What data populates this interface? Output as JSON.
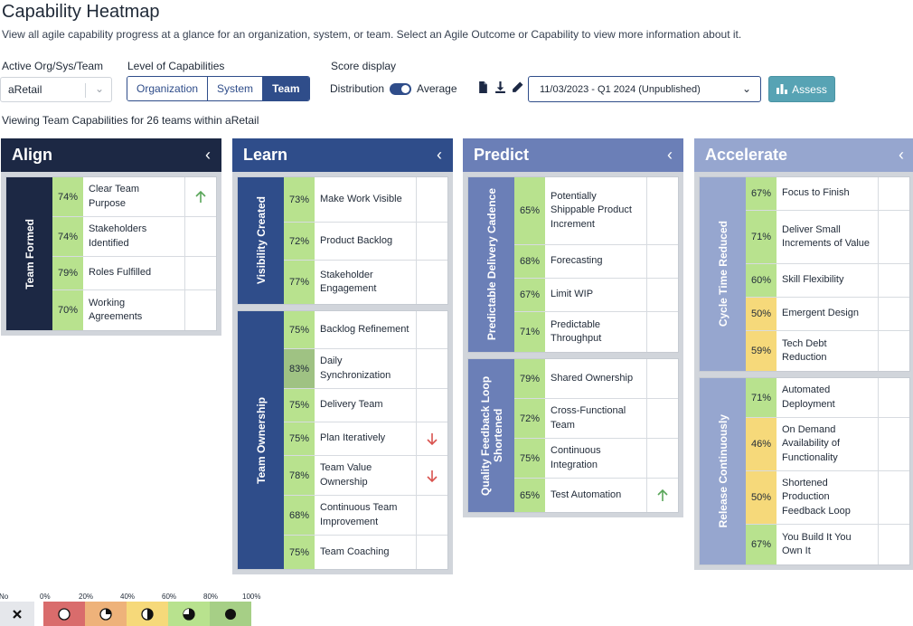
{
  "page": {
    "title": "Capability Heatmap",
    "subtitle": "View all agile capability progress at a glance for an organization, system, or team. Select an Agile Outcome or Capability to view more information about it."
  },
  "controls": {
    "org_label": "Active Org/Sys/Team",
    "org_value": "aRetail",
    "level_label": "Level of Capabilities",
    "levels": [
      "Organization",
      "System",
      "Team"
    ],
    "level_selected": "Team",
    "score_label": "Score display",
    "score_left": "Distribution",
    "score_right": "Average",
    "score_mode": "Average",
    "date_value": "11/03/2023 - Q1 2024 (Unpublished)",
    "assess_label": "Assess"
  },
  "viewing_text": "Viewing Team Capabilities for 26 teams within aRetail",
  "colors": {
    "align": "#1c2844",
    "learn": "#2f4d8a",
    "predict": "#6b7fb7",
    "accelerate": "#96a6cf",
    "scale_0_20": "#d96c6c",
    "scale_20_40": "#eeb27a",
    "scale_40_60": "#f6d97a",
    "scale_60_80": "#b8e28e",
    "scale_80_100": "#a6cf86",
    "no_value": "#e5e7eb"
  },
  "columns": [
    {
      "title": "Align",
      "groups": [
        {
          "label": "Team Formed",
          "rows": [
            {
              "pct": "74%",
              "name": "Clear Team Purpose",
              "trend": "up"
            },
            {
              "pct": "74%",
              "name": "Stakeholders Identified",
              "trend": ""
            },
            {
              "pct": "79%",
              "name": "Roles Fulfilled",
              "trend": ""
            },
            {
              "pct": "70%",
              "name": "Working Agreements",
              "trend": ""
            }
          ]
        }
      ]
    },
    {
      "title": "Learn",
      "groups": [
        {
          "label": "Visibility Created",
          "rows": [
            {
              "pct": "73%",
              "name": "Make Work Visible",
              "trend": ""
            },
            {
              "pct": "72%",
              "name": "Product Backlog",
              "trend": ""
            },
            {
              "pct": "77%",
              "name": "Stakeholder Engagement",
              "trend": ""
            }
          ]
        },
        {
          "label": "Team Ownership",
          "rows": [
            {
              "pct": "75%",
              "name": "Backlog Refinement",
              "trend": ""
            },
            {
              "pct": "83%",
              "name": "Daily Synchronization",
              "trend": ""
            },
            {
              "pct": "75%",
              "name": "Delivery Team",
              "trend": ""
            },
            {
              "pct": "75%",
              "name": "Plan Iteratively",
              "trend": "down"
            },
            {
              "pct": "78%",
              "name": "Team Value Ownership",
              "trend": "down"
            },
            {
              "pct": "68%",
              "name": "Continuous Team Improvement",
              "trend": ""
            },
            {
              "pct": "75%",
              "name": "Team Coaching",
              "trend": ""
            }
          ]
        }
      ]
    },
    {
      "title": "Predict",
      "groups": [
        {
          "label": "Predictable Delivery Cadence",
          "rows": [
            {
              "pct": "65%",
              "name": "Potentially Shippable Product Increment",
              "trend": ""
            },
            {
              "pct": "68%",
              "name": "Forecasting",
              "trend": ""
            },
            {
              "pct": "67%",
              "name": "Limit WIP",
              "trend": ""
            },
            {
              "pct": "71%",
              "name": "Predictable Throughput",
              "trend": ""
            }
          ]
        },
        {
          "label": "Quality Feedback Loop Shortened",
          "rows": [
            {
              "pct": "79%",
              "name": "Shared Ownership",
              "trend": ""
            },
            {
              "pct": "72%",
              "name": "Cross-Functional Team",
              "trend": ""
            },
            {
              "pct": "75%",
              "name": "Continuous Integration",
              "trend": ""
            },
            {
              "pct": "65%",
              "name": "Test Automation",
              "trend": "up"
            }
          ]
        }
      ]
    },
    {
      "title": "Accelerate",
      "groups": [
        {
          "label": "Cycle Time Reduced",
          "rows": [
            {
              "pct": "67%",
              "name": "Focus to Finish",
              "trend": ""
            },
            {
              "pct": "71%",
              "name": "Deliver Small Increments of Value",
              "trend": ""
            },
            {
              "pct": "60%",
              "name": "Skill Flexibility",
              "trend": ""
            },
            {
              "pct": "50%",
              "name": "Emergent Design",
              "trend": ""
            },
            {
              "pct": "59%",
              "name": "Tech Debt Reduction",
              "trend": ""
            }
          ]
        },
        {
          "label": "Release Continuously",
          "rows": [
            {
              "pct": "71%",
              "name": "Automated Deployment",
              "trend": ""
            },
            {
              "pct": "46%",
              "name": "On Demand Availability of Functionality",
              "trend": ""
            },
            {
              "pct": "50%",
              "name": "Shortened Production Feedback Loop",
              "trend": ""
            },
            {
              "pct": "67%",
              "name": "You Build It You Own It",
              "trend": ""
            }
          ]
        }
      ]
    }
  ],
  "legend": {
    "no_value_label": "No Value",
    "ticks": [
      "0%",
      "20%",
      "40%",
      "60%",
      "80%",
      "100%"
    ]
  }
}
